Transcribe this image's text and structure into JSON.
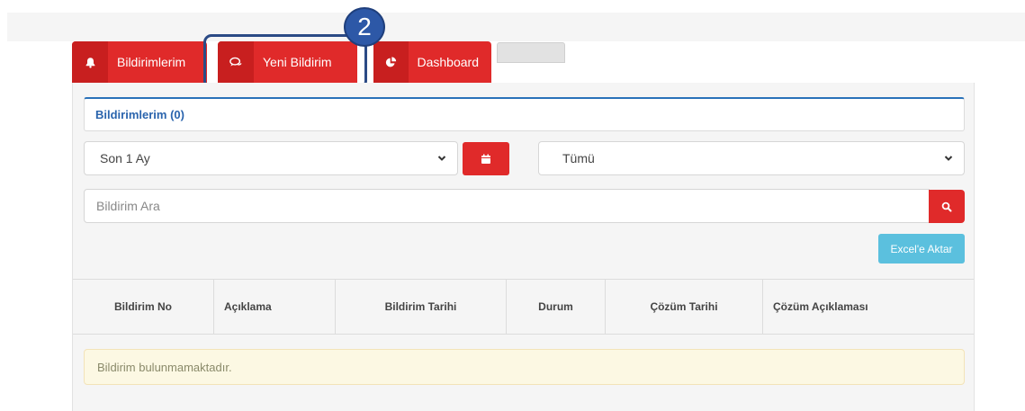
{
  "tabs": [
    {
      "label": "Bildirimlerim",
      "icon": "bell-icon"
    },
    {
      "label": "Yeni Bildirim",
      "icon": "chat-icon"
    },
    {
      "label": "Dashboard",
      "icon": "pie-chart-icon"
    }
  ],
  "callout": {
    "number": "2",
    "color": "#2d58a7"
  },
  "panel": {
    "title": "Bildirimlerim (0)"
  },
  "filters": {
    "period_selected": "Son 1 Ay",
    "status_selected": "Tümü",
    "calendar_icon": "calendar-icon"
  },
  "search": {
    "placeholder": "Bildirim Ara",
    "icon": "search-icon"
  },
  "excel_button": "Excel'e Aktar",
  "table": {
    "columns": [
      "Bildirim No",
      "Açıklama",
      "Bildirim Tarihi",
      "Durum",
      "Çözüm Tarihi",
      "Çözüm Açıklaması"
    ]
  },
  "empty_message": "Bildirim bulunmamaktadır.",
  "colors": {
    "primary_red": "#e02a2a",
    "accent_blue": "#2a64ad",
    "info": "#5bc0de",
    "warning_bg": "#fcf8e3"
  }
}
